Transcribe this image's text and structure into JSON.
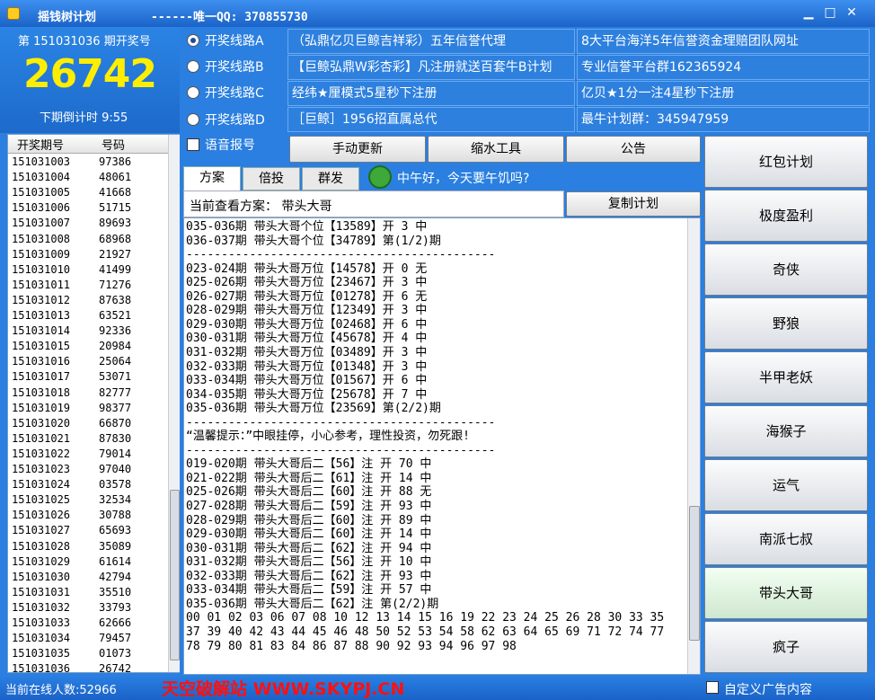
{
  "window": {
    "title": "摇钱树计划",
    "title_extra": "------唯一QQ: 370855730",
    "min": "▁",
    "max": "□",
    "close": "✕"
  },
  "draw": {
    "period_label": "第 151031036 期开奖号",
    "number": "26742",
    "countdown": "下期倒计时 9:55"
  },
  "lines": [
    {
      "label": "开奖线路A",
      "checked": true
    },
    {
      "label": "开奖线路B",
      "checked": false
    },
    {
      "label": "开奖线路C",
      "checked": false
    },
    {
      "label": "开奖线路D",
      "checked": false
    }
  ],
  "voice_label": "语音报号",
  "ads": [
    "（弘鼎亿贝巨鲸吉祥彩）五年信誉代理",
    "8大平台海洋5年信誉资金理赔团队网址",
    "【巨鲸弘鼎W彩杏彩】凡注册就送百套牛B计划",
    "专业信誉平台群162365924",
    "经纬★厘模式5星秒下注册",
    "亿贝★1分一注4星秒下注册",
    "［巨鲸］1956招直属总代",
    "最牛计划群：345947959"
  ],
  "history": {
    "col_period": "开奖期号",
    "col_number": "号码",
    "rows": [
      [
        "151031003",
        "97386"
      ],
      [
        "151031004",
        "48061"
      ],
      [
        "151031005",
        "41668"
      ],
      [
        "151031006",
        "51715"
      ],
      [
        "151031007",
        "89693"
      ],
      [
        "151031008",
        "68968"
      ],
      [
        "151031009",
        "21927"
      ],
      [
        "151031010",
        "41499"
      ],
      [
        "151031011",
        "71276"
      ],
      [
        "151031012",
        "87638"
      ],
      [
        "151031013",
        "63521"
      ],
      [
        "151031014",
        "92336"
      ],
      [
        "151031015",
        "20984"
      ],
      [
        "151031016",
        "25064"
      ],
      [
        "151031017",
        "53071"
      ],
      [
        "151031018",
        "82777"
      ],
      [
        "151031019",
        "98377"
      ],
      [
        "151031020",
        "66870"
      ],
      [
        "151031021",
        "87830"
      ],
      [
        "151031022",
        "79014"
      ],
      [
        "151031023",
        "97040"
      ],
      [
        "151031024",
        "03578"
      ],
      [
        "151031025",
        "32534"
      ],
      [
        "151031026",
        "30788"
      ],
      [
        "151031027",
        "65693"
      ],
      [
        "151031028",
        "35089"
      ],
      [
        "151031029",
        "61614"
      ],
      [
        "151031030",
        "42794"
      ],
      [
        "151031031",
        "35510"
      ],
      [
        "151031032",
        "33793"
      ],
      [
        "151031033",
        "62666"
      ],
      [
        "151031034",
        "79457"
      ],
      [
        "151031035",
        "01073"
      ],
      [
        "151031036",
        "26742"
      ]
    ]
  },
  "toolbar": {
    "manual_update": "手动更新",
    "shrink_tool": "缩水工具",
    "notice": "公告"
  },
  "tabs": [
    "方案",
    "倍投",
    "群发"
  ],
  "greeting": "中午好，今天要午饥吗?",
  "scheme_label": "当前查看方案：  带头大哥",
  "copy_plan": "复制计划",
  "plan_lines": [
    "035-036期 带头大哥个位【13589】开 3 中",
    "036-037期 带头大哥个位【34789】第(1/2)期",
    "--------------------------------------------",
    "023-024期 带头大哥万位【14578】开 0 无",
    "025-026期 带头大哥万位【23467】开 3 中",
    "026-027期 带头大哥万位【01278】开 6 无",
    "028-029期 带头大哥万位【12349】开 3 中",
    "029-030期 带头大哥万位【02468】开 6 中",
    "030-031期 带头大哥万位【45678】开 4 中",
    "031-032期 带头大哥万位【03489】开 3 中",
    "032-033期 带头大哥万位【01348】开 3 中",
    "033-034期 带头大哥万位【01567】开 6 中",
    "034-035期 带头大哥万位【25678】开 7 中",
    "035-036期 带头大哥万位【23569】第(2/2)期",
    "--------------------------------------------",
    "“温馨提示：”中眼挂停，小心参考，理性投资，勿死跟!",
    "--------------------------------------------",
    "019-020期 带头大哥后二【56】注 开 70 中",
    "021-022期 带头大哥后二【61】注 开 14 中",
    "025-026期 带头大哥后二【60】注 开 88 无",
    "027-028期 带头大哥后二【59】注 开 93 中",
    "028-029期 带头大哥后二【60】注 开 89 中",
    "029-030期 带头大哥后二【60】注 开 14 中",
    "030-031期 带头大哥后二【62】注 开 94 中",
    "031-032期 带头大哥后二【56】注 开 10 中",
    "032-033期 带头大哥后二【62】注 开 93 中",
    "033-034期 带头大哥后二【59】注 开 57 中",
    "035-036期 带头大哥后二【62】注 第(2/2)期",
    "00 01 02 03 06 07 08 10 12 13 14 15 16 19 22 23 24 25 26 28 30 33 35",
    "37 39 40 42 43 44 45 46 48 50 52 53 54 58 62 63 64 65 69 71 72 74 77",
    "78 79 80 81 83 84 86 87 88 90 92 93 94 96 97 98"
  ],
  "side_buttons": [
    "红包计划",
    "极度盈利",
    "奇侠",
    "野狼",
    "半甲老妖",
    "海猴子",
    "运气",
    "南派七叔",
    "带头大哥",
    "疯子"
  ],
  "active_side": "带头大哥",
  "status": {
    "online": "当前在线人数:52966",
    "promo": "天空破解站 WWW.SKYPJ.CN",
    "custom_ad": "自定义广告内容"
  }
}
